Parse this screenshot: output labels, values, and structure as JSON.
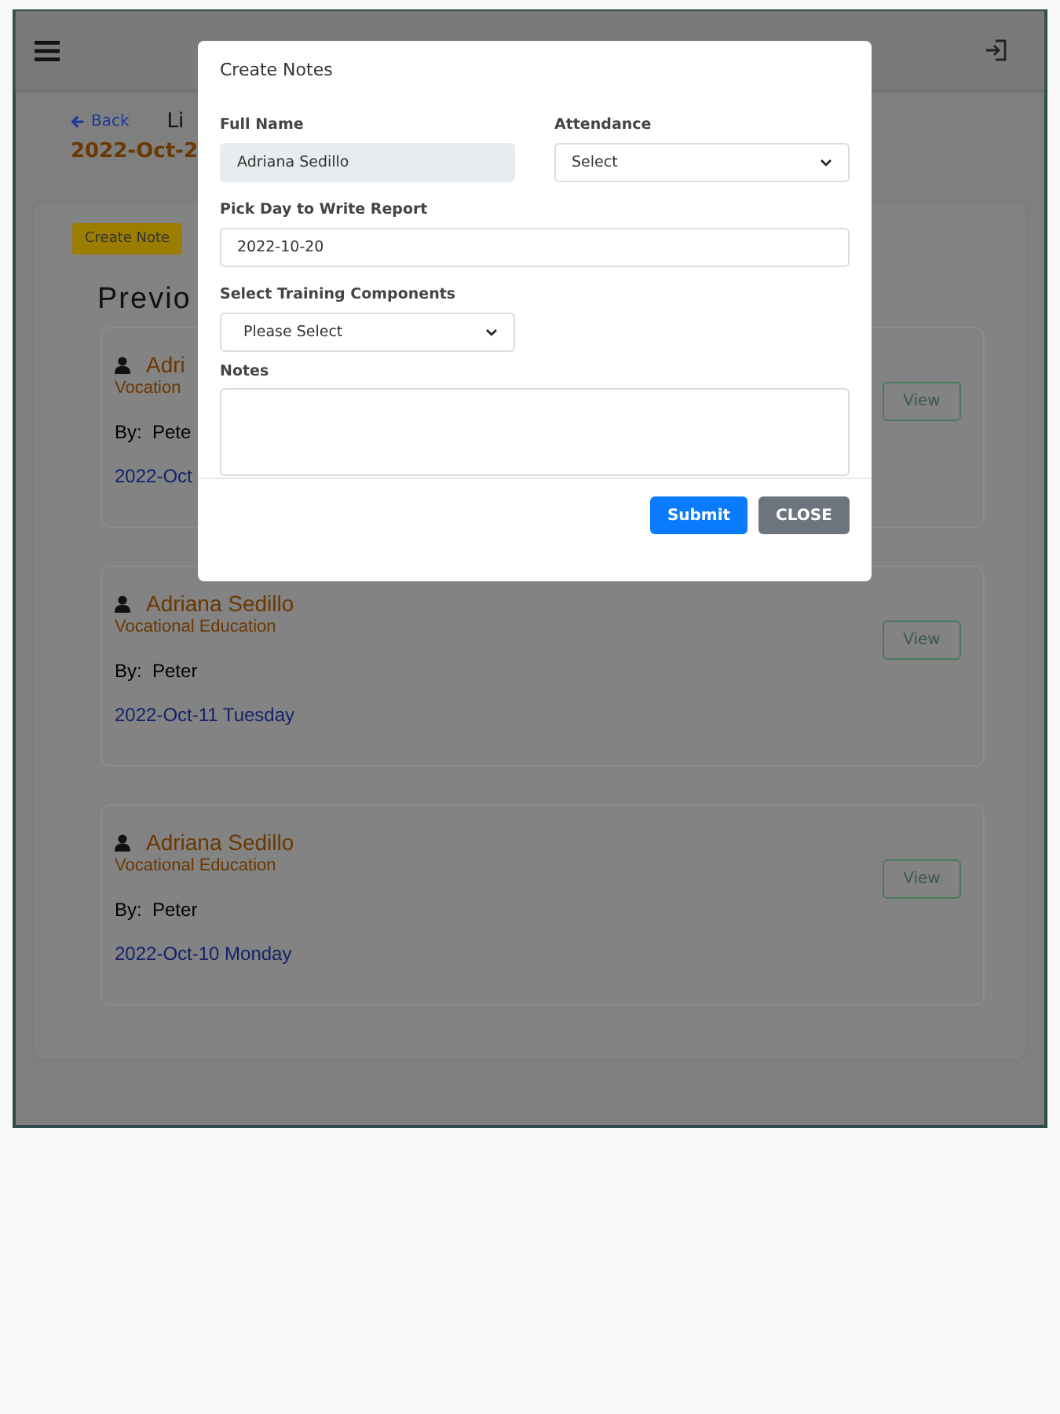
{
  "page": {
    "back": "Back",
    "title": "Li",
    "date": "2022-Oct-2",
    "create_button": "Create Note",
    "section_title": "Previo"
  },
  "cards": [
    {
      "name": "Adri",
      "program": "Vocation",
      "by_label": "By:",
      "by": "Pete",
      "date": "2022-Oct",
      "view": "View"
    },
    {
      "name": "Adriana Sedillo",
      "program": "Vocational Education",
      "by_label": "By:",
      "by": "Peter",
      "date": "2022-Oct-11 Tuesday",
      "view": "View"
    },
    {
      "name": "Adriana Sedillo",
      "program": "Vocational Education",
      "by_label": "By:",
      "by": "Peter",
      "date": "2022-Oct-10 Monday",
      "view": "View"
    }
  ],
  "modal": {
    "title": "Create Notes",
    "full_name_label": "Full Name",
    "full_name": "Adriana Sedillo",
    "attendance_label": "Attendance",
    "attendance": "Select",
    "day_label": "Pick Day to Write Report",
    "day": "2022-10-20",
    "components_label": "Select Training Components",
    "components": "Please Select",
    "notes_label": "Notes",
    "submit": "Submit",
    "close": "CLOSE"
  }
}
